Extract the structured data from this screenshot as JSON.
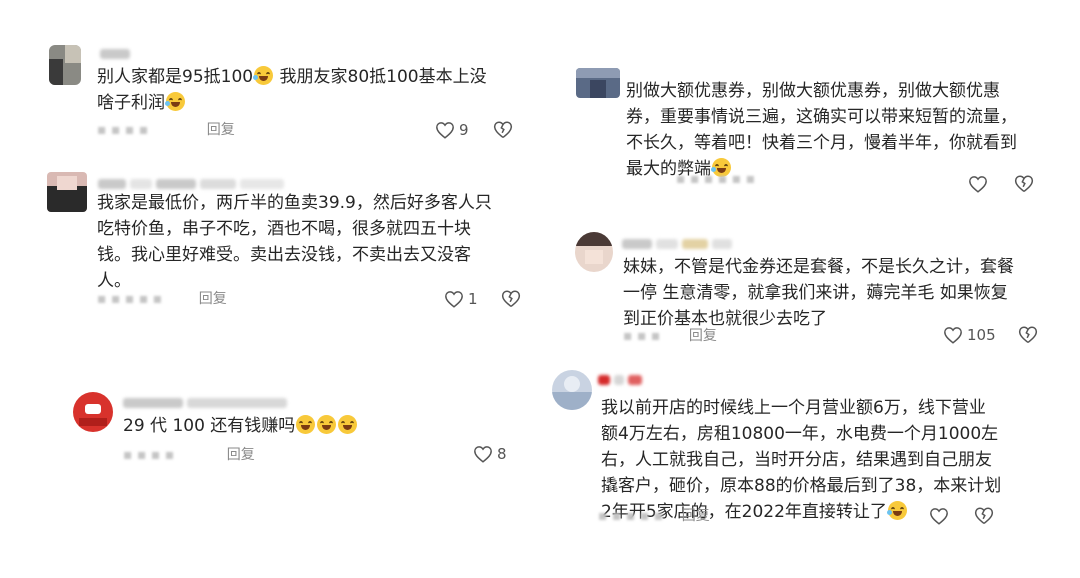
{
  "reply_label": "回复",
  "comments": [
    {
      "text_a": "别人家都是95抵100",
      "text_b": " 我朋友家80抵100基本上没\n啥子利润",
      "likes": "9"
    },
    {
      "text": "我家是最低价，两斤半的鱼卖39.9，然后好多客人只\n吃特价鱼，串子不吃，酒也不喝，很多就四五十块\n钱。我心里好难受。卖出去没钱，不卖出去又没客\n人。",
      "likes": "1"
    },
    {
      "text": "29 代 100 还有钱赚吗",
      "likes": "8"
    },
    {
      "text": "别做大额优惠券，别做大额优惠券，别做大额优惠\n券，重要事情说三遍，这确实可以带来短暂的流量，\n不长久，等着吧！快着三个月，慢着半年，你就看到\n最大的弊端",
      "likes": ""
    },
    {
      "text": "妹妹，不管是代金券还是套餐，不是长久之计，套餐\n一停 生意清零，就拿我们来讲，薅完羊毛 如果恢复\n到正价基本也就很少去吃了",
      "likes": "105"
    },
    {
      "text": "我以前开店的时候线上一个月营业额6万，线下营业\n额4万左右，房租10800一年，水电费一个月1000左\n右，人工就我自己，当时开分店，结果遇到自己朋友\n撬客户，砸价，原本88的价格最后到了38，本来计划\n2年开5家店的，在2022年直接转让了",
      "likes": ""
    }
  ],
  "colors": {
    "text": "#262626",
    "meta": "#9a9a9a",
    "emoji": "#f8c93a"
  }
}
